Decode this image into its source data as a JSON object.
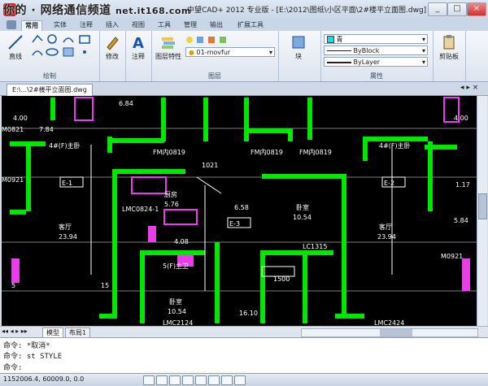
{
  "title_bar": {
    "watermark": "你的 · 网络通信频道",
    "site": "net.it168.com",
    "title": "中望CAD+ 2012 专业版 - [E:\\2012\\图纸\\小区平面\\2#楼平立面图.dwg]",
    "buttons": [
      "_",
      "□",
      "×"
    ]
  },
  "ribbon": {
    "tabs": [
      "常用",
      "实体",
      "注释",
      "插入",
      "视图",
      "工具",
      "管理",
      "输出",
      "扩展工具"
    ],
    "active_tab": "常用",
    "groups": {
      "draw": {
        "title": "绘制",
        "line_label": "直线"
      },
      "modify": {
        "label": "修改"
      },
      "annotate": {
        "label": "注释"
      },
      "layers": {
        "title": "图层",
        "props_label": "图层特性",
        "current_layer": "01-movfur"
      },
      "block": {
        "label": "块"
      },
      "properties": {
        "title": "属性",
        "color": "青",
        "linetype": "ByBlock",
        "lineweight": "ByLayer"
      },
      "clipboard": {
        "label": "剪贴板"
      }
    }
  },
  "document": {
    "tab": "E:\\...\\2#楼平立面图.dwg"
  },
  "drawing": {
    "labels": [
      {
        "text": "6.84"
      },
      {
        "text": "M0821"
      },
      {
        "text": "4.00"
      },
      {
        "text": "M0921"
      },
      {
        "text": "7.84"
      },
      {
        "text": "4#(F)主卧"
      },
      {
        "text": "E-1"
      },
      {
        "text": "客厅"
      },
      {
        "text": "23.94"
      },
      {
        "text": "FM内0819"
      },
      {
        "text": "FM内0819"
      },
      {
        "text": "FM内0819"
      },
      {
        "text": "1021"
      },
      {
        "text": "厨房"
      },
      {
        "text": "5.76"
      },
      {
        "text": "LMC0824-1"
      },
      {
        "text": "4.08"
      },
      {
        "text": "6.58"
      },
      {
        "text": "E-3"
      },
      {
        "text": "卧室"
      },
      {
        "text": "10.54"
      },
      {
        "text": "LC1315"
      },
      {
        "text": "4#(F)主卧"
      },
      {
        "text": "E-2"
      },
      {
        "text": "客厅"
      },
      {
        "text": "23.94"
      },
      {
        "text": "1.17"
      },
      {
        "text": "5.84"
      },
      {
        "text": "4.00"
      },
      {
        "text": "M0921"
      },
      {
        "text": "5(F)主卫"
      },
      {
        "text": "卧室"
      },
      {
        "text": "10.54"
      },
      {
        "text": "LMC2124"
      },
      {
        "text": "16.10"
      },
      {
        "text": "LMC2424"
      },
      {
        "text": "1500"
      },
      {
        "text": "15"
      },
      {
        "text": "5"
      }
    ]
  },
  "layout_tabs": [
    "模型",
    "布局1"
  ],
  "command": {
    "lines": [
      "命令: *取消*",
      "命令:  st STYLE",
      "命令:"
    ]
  },
  "status": {
    "coordinates": "1152006.4, 60009.0, 0.0"
  }
}
